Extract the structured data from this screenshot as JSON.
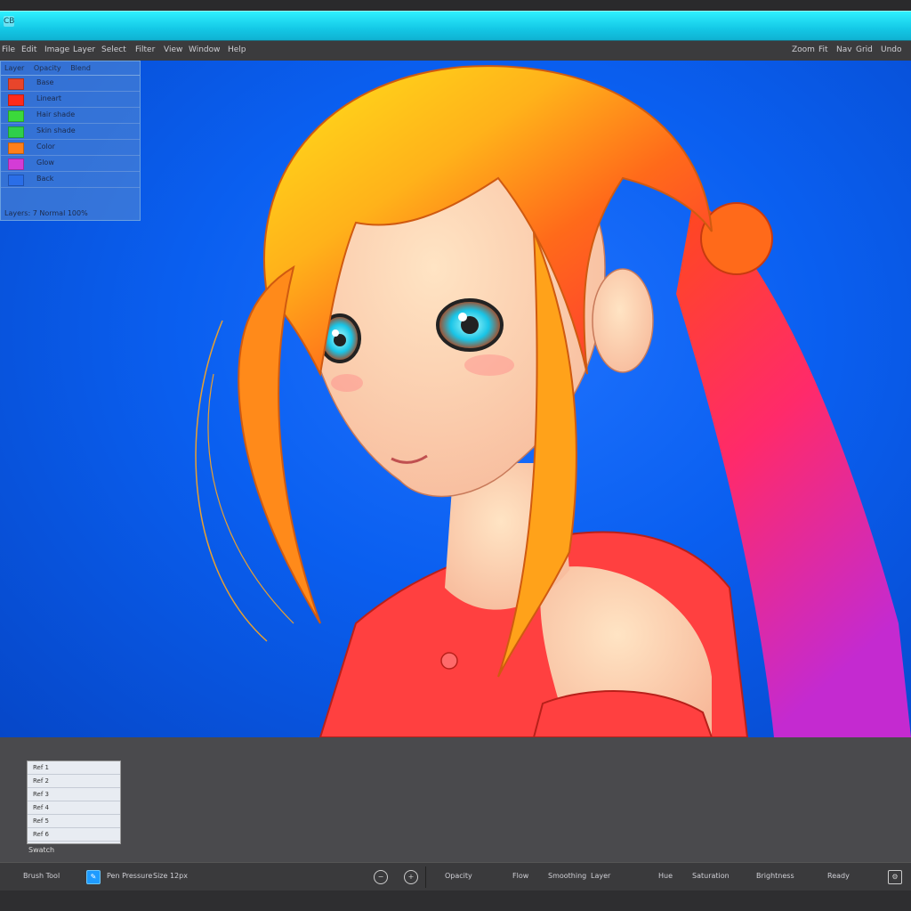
{
  "window": {
    "app_icon_label": "CB"
  },
  "menu": {
    "left_items": [
      "File",
      "Edit",
      "Image",
      "Layer",
      "Select",
      "Filter",
      "View",
      "Window",
      "Help"
    ],
    "right_items": [
      "Zoom",
      "Fit",
      "Nav",
      "Grid",
      "Undo"
    ]
  },
  "layers": {
    "header": [
      "Layer",
      "Opacity",
      "Blend"
    ],
    "rows": [
      {
        "name": "Base",
        "color": "#e8452b"
      },
      {
        "name": "Lineart",
        "color": "#ff2a1a"
      },
      {
        "name": "Hair shade",
        "color": "#3bd93b"
      },
      {
        "name": "Skin shade",
        "color": "#2fcf4a"
      },
      {
        "name": "Color",
        "color": "#ff7f1a"
      },
      {
        "name": "Glow",
        "color": "#d43cd6"
      },
      {
        "name": "Back",
        "color": "#2a6ee8"
      }
    ],
    "footer": "Layers: 7  Normal  100%"
  },
  "mini_panel": {
    "rows": [
      "Ref 1",
      "Ref 2",
      "Ref 3",
      "Ref 4",
      "Ref 5",
      "Ref 6"
    ],
    "caption": "Swatch"
  },
  "status": {
    "items": [
      "Brush Tool",
      "Pen Pressure",
      "Size 12px",
      "Opacity",
      "Flow",
      "Smoothing",
      "Layer",
      "Hue",
      "Saturation",
      "Brightness",
      "Ready"
    ],
    "active_icon": "brush-icon"
  },
  "colors": {
    "canvas_bg": "#0a5ff0",
    "titlebar": "#14c8e6",
    "accent": "#1e9bff"
  }
}
